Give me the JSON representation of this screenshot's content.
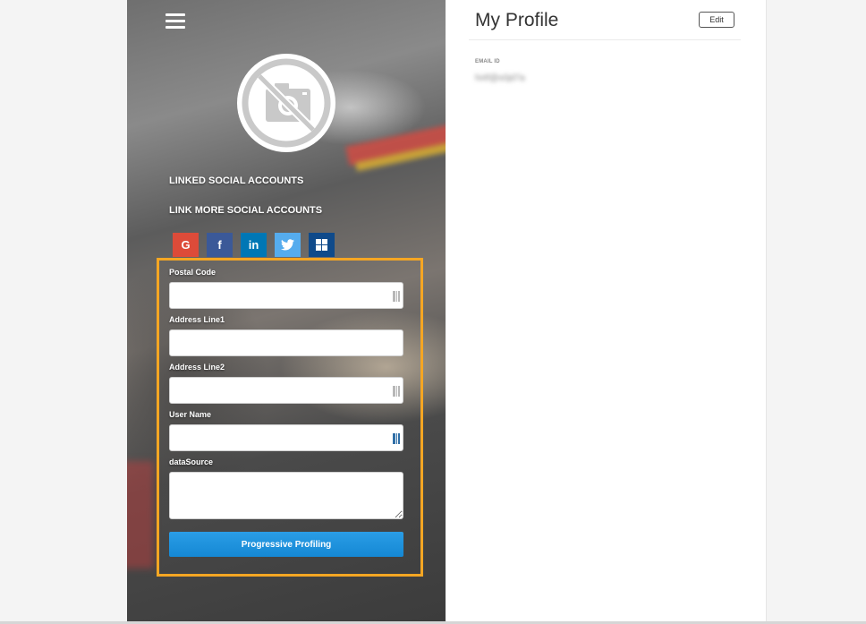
{
  "profile": {
    "title": "My Profile",
    "edit_label": "Edit",
    "email_label": "EMAIL ID",
    "email_value": "hi4f@s0jd7a"
  },
  "sidebar": {
    "menu_icon": "hamburger-menu-icon",
    "avatar_icon": "no-camera-icon",
    "linked_accounts_title": "LINKED SOCIAL ACCOUNTS",
    "link_more_title": "LINK MORE SOCIAL ACCOUNTS",
    "social": [
      {
        "name": "google",
        "glyph": "G",
        "color": "#dd4b39"
      },
      {
        "name": "facebook",
        "glyph": "f",
        "color": "#3b5998"
      },
      {
        "name": "linkedin",
        "glyph": "in",
        "color": "#0077b5"
      },
      {
        "name": "twitter",
        "glyph": "twitter-bird-icon",
        "color": "#55acee"
      },
      {
        "name": "windows",
        "glyph": "windows-logo-icon",
        "color": "#0f4a8a"
      }
    ]
  },
  "form": {
    "fields": [
      {
        "label": "Postal Code",
        "value": ""
      },
      {
        "label": "Address Line1",
        "value": ""
      },
      {
        "label": "Address Line2",
        "value": ""
      },
      {
        "label": "User Name",
        "value": ""
      },
      {
        "label": "dataSource",
        "value": ""
      }
    ],
    "submit_label": "Progressive Profiling"
  },
  "colors": {
    "accent": "#1f94df",
    "highlight": "#f5a623"
  }
}
